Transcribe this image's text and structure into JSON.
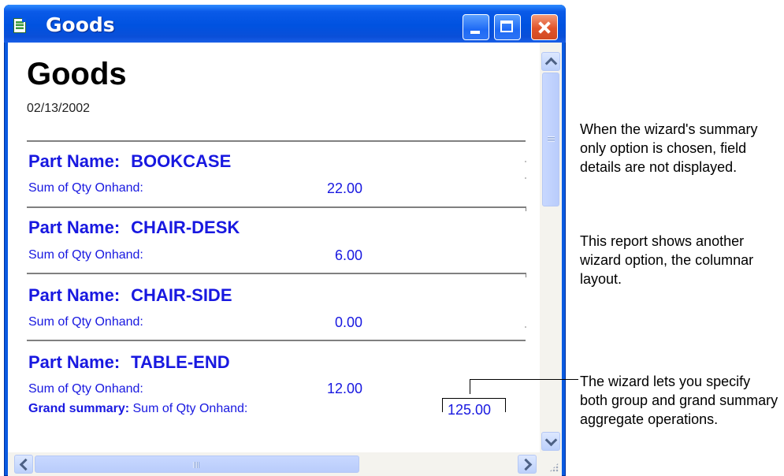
{
  "window": {
    "title": "Goods",
    "app_icon": "report-document-icon",
    "controls": {
      "minimize": "minimize-icon",
      "maximize": "maximize-icon",
      "close": "close-icon"
    }
  },
  "report": {
    "title": "Goods",
    "date": "02/13/2002",
    "groups": [
      {
        "label": "Part Name:",
        "value": "BOOKCASE",
        "sum_label": "Sum of Qty Onhand:",
        "sum_value": "22.00"
      },
      {
        "label": "Part Name:",
        "value": "CHAIR-DESK",
        "sum_label": "Sum of Qty Onhand:",
        "sum_value": "6.00"
      },
      {
        "label": "Part Name:",
        "value": "CHAIR-SIDE",
        "sum_label": "Sum of Qty Onhand:",
        "sum_value": "0.00"
      },
      {
        "label": "Part Name:",
        "value": "TABLE-END",
        "sum_label": "Sum of Qty Onhand:",
        "sum_value": "12.00"
      }
    ],
    "grand": {
      "bold_label": "Grand summary:",
      "label": "Sum of Qty Onhand:",
      "value": "125.00"
    }
  },
  "annotations": {
    "note1": "When the wizard's summary only option is chosen, field details are not displayed.",
    "note2": "This report shows another wizard option, the columnar layout.",
    "note3": "The wizard lets you specify both group and grand summary aggregate operations."
  },
  "colors": {
    "titlebar": "#0a5ae0",
    "report_text": "#1818e0",
    "close_button": "#e0532a"
  }
}
